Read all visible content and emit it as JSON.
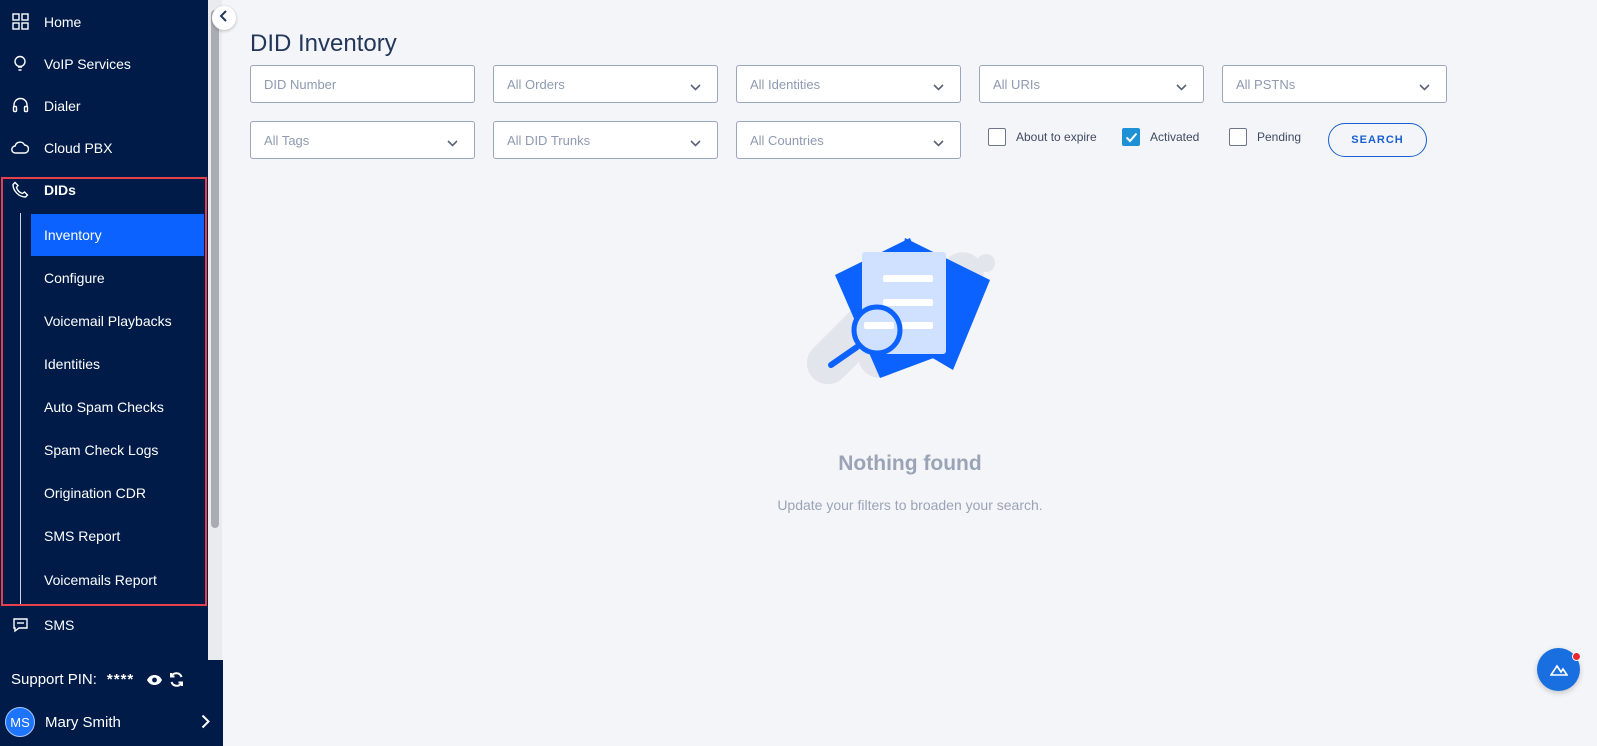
{
  "sidebar": {
    "items": [
      {
        "label": "Home",
        "icon": "grid-icon"
      },
      {
        "label": "VoIP Services",
        "icon": "bulb-icon"
      },
      {
        "label": "Dialer",
        "icon": "headset-icon"
      },
      {
        "label": "Cloud PBX",
        "icon": "cloud-phone-icon"
      },
      {
        "label": "DIDs",
        "icon": "phone-icon"
      },
      {
        "label": "SMS",
        "icon": "chat-icon"
      }
    ],
    "dids_sub": [
      {
        "label": "Inventory",
        "active": true
      },
      {
        "label": "Configure"
      },
      {
        "label": "Voicemail Playbacks"
      },
      {
        "label": "Identities"
      },
      {
        "label": "Auto Spam Checks"
      },
      {
        "label": "Spam Check Logs"
      },
      {
        "label": "Origination CDR"
      },
      {
        "label": "SMS Report"
      },
      {
        "label": "Voicemails Report"
      }
    ],
    "support_label": "Support PIN:",
    "support_pin": "****",
    "user_initials": "MS",
    "user_name": "Mary Smith"
  },
  "page": {
    "title": "DID Inventory"
  },
  "filters": {
    "did_number_placeholder": "DID Number",
    "orders": "All Orders",
    "identities": "All Identities",
    "uris": "All URIs",
    "pstns": "All PSTNs",
    "tags": "All Tags",
    "did_trunks": "All DID Trunks",
    "countries": "All Countries",
    "checks": [
      {
        "label": "About to expire",
        "checked": false
      },
      {
        "label": "Activated",
        "checked": true
      },
      {
        "label": "Pending",
        "checked": false
      }
    ],
    "search_label": "SEARCH"
  },
  "empty": {
    "title": "Nothing found",
    "subtitle": "Update your filters to broaden your search."
  },
  "colors": {
    "sidebar_bg": "#001b48",
    "accent": "#0b62ff",
    "highlight_border": "#e5414b"
  }
}
